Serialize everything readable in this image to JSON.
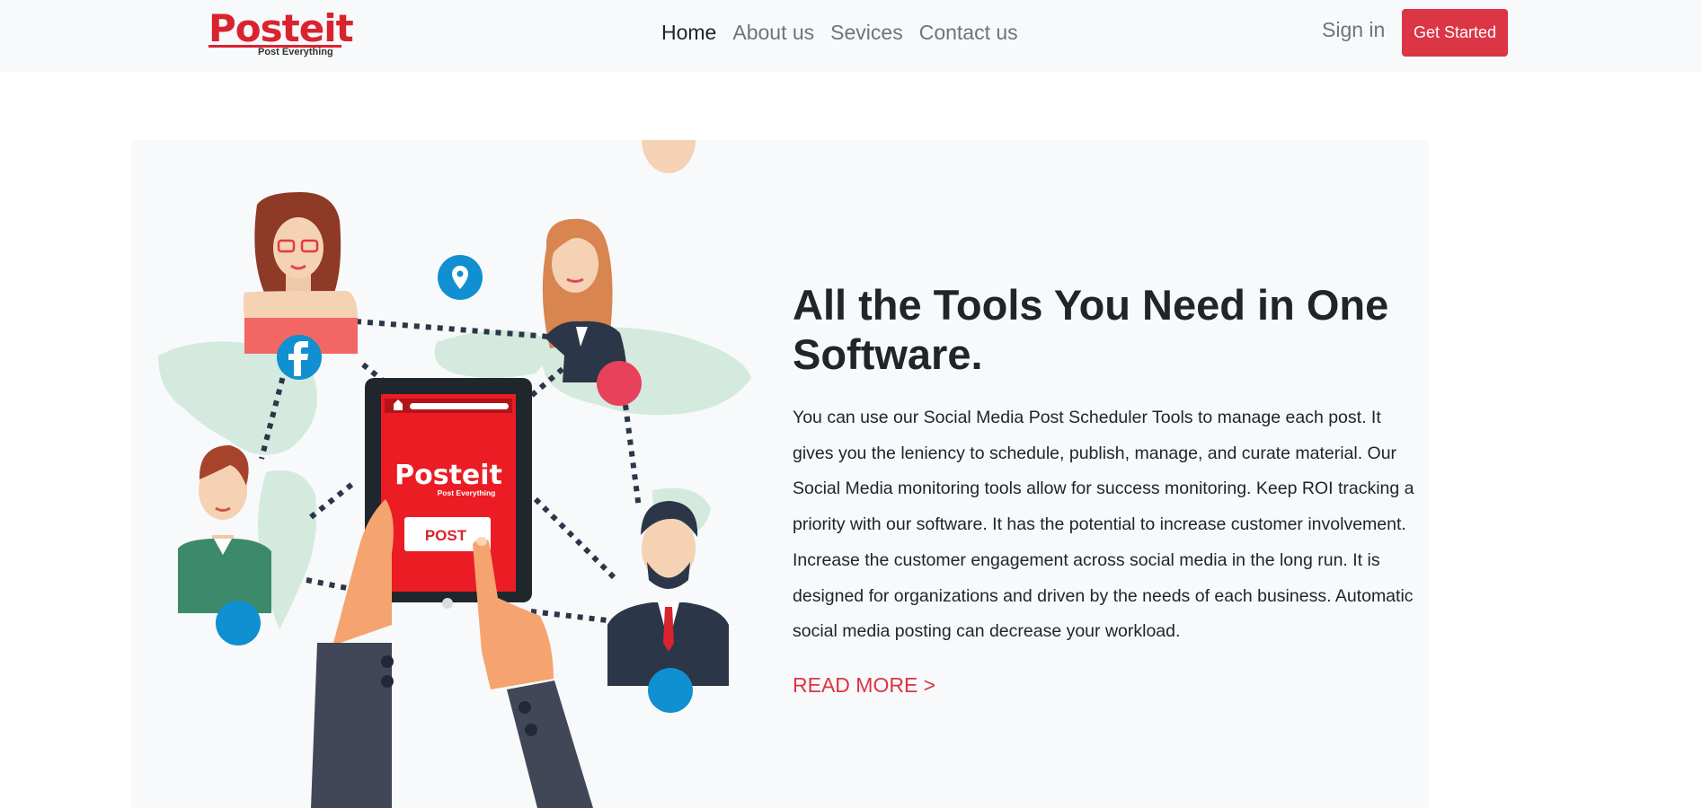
{
  "brand": {
    "logo_text": "Posteit",
    "tagline": "Post Everything",
    "brand_color": "#d9232f"
  },
  "nav": {
    "links": [
      {
        "label": "Home",
        "active": true
      },
      {
        "label": "About us",
        "active": false
      },
      {
        "label": "Sevices",
        "active": false
      },
      {
        "label": "Contact us",
        "active": false
      }
    ],
    "sign_in": "Sign in",
    "cta": "Get Started",
    "cta_color": "#dc3545"
  },
  "hero": {
    "title": "All the Tools You Need in One Software.",
    "description": "You can use our Social Media Post Scheduler Tools to manage each post. It gives you the leniency to schedule, publish, manage, and curate material. Our Social Media monitoring tools allow for success monitoring. Keep ROI tracking a priority with our software. It has the potential to increase customer involvement. Increase the customer engagement across social media in the long run. It is designed for organizations and driven by the needs of each business. Automatic social media posting can decrease your workload.",
    "read_more": "READ MORE >",
    "illustration": {
      "tablet_logo": "Posteit",
      "tablet_tagline": "Post Everything",
      "post_button": "POST",
      "icons": [
        "facebook-icon",
        "location-pin-icon",
        "home-icon"
      ]
    }
  }
}
